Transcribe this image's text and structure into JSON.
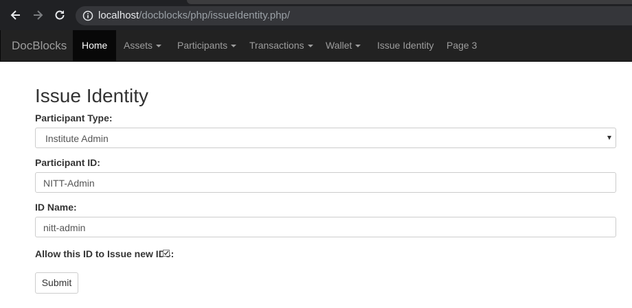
{
  "browser": {
    "url_host": "localhost",
    "url_path": "/docblocks/php/issueIdentity.php/"
  },
  "navbar": {
    "brand": "DocBlocks",
    "items": [
      {
        "label": "Home",
        "active": true,
        "dropdown": false
      },
      {
        "label": "Assets",
        "active": false,
        "dropdown": true
      },
      {
        "label": "Participants",
        "active": false,
        "dropdown": true
      },
      {
        "label": "Transactions",
        "active": false,
        "dropdown": true
      },
      {
        "label": "Wallet",
        "active": false,
        "dropdown": true
      },
      {
        "label": "Issue Identity",
        "active": false,
        "dropdown": false
      },
      {
        "label": "Page 3",
        "active": false,
        "dropdown": false
      }
    ]
  },
  "form": {
    "title": "Issue Identity",
    "participant_type_label": "Participant Type:",
    "participant_type_value": "Institute Admin",
    "participant_id_label": "Participant ID:",
    "participant_id_value": "NITT-Admin",
    "id_name_label": "ID Name:",
    "id_name_value": "nitt-admin",
    "allow_issue_label": "Allow this ID to Issue new IDs:",
    "allow_issue_checked": true,
    "submit_label": "Submit"
  },
  "colors": {
    "browser_bg": "#202124",
    "navbar_bg": "#222222",
    "navbar_active_bg": "#080808",
    "navbar_text": "#9d9d9d"
  }
}
